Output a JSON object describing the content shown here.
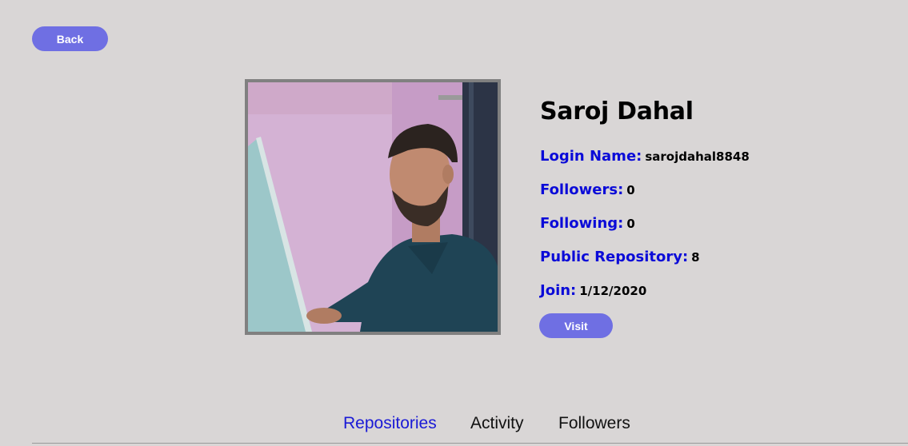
{
  "nav": {
    "back_label": "Back"
  },
  "profile": {
    "name": "Saroj Dahal",
    "login_label": "Login Name:",
    "login_value": "sarojdahal8848",
    "followers_label": "Followers:",
    "followers_value": "0",
    "following_label": "Following:",
    "following_value": "0",
    "repos_label": "Public Repository:",
    "repos_value": "8",
    "join_label": "Join:",
    "join_value": "1/12/2020",
    "visit_label": "Visit"
  },
  "tabs": [
    {
      "label": "Repositories",
      "active": true
    },
    {
      "label": "Activity",
      "active": false
    },
    {
      "label": "Followers",
      "active": false
    }
  ],
  "colors": {
    "background": "#d9d6d6",
    "button": "#6f6fe3",
    "label_blue": "#0b0bd8",
    "active_tab": "#1a1ad6"
  }
}
